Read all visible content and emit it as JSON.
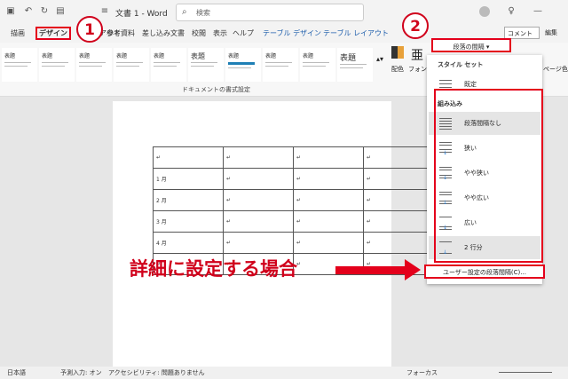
{
  "titlebar": {
    "doc_title": "文書 1 - Word",
    "search_placeholder": "検索"
  },
  "menu": {
    "tabs": [
      "描画",
      "デザイン",
      "レイアウト",
      "参考資料",
      "差し込み文書",
      "校閲",
      "表示",
      "ヘルプ",
      "テーブル デザイン",
      "テーブル レイアウト"
    ],
    "comment": "コメント",
    "edit": "編集"
  },
  "ribbon": {
    "gallery_caption": "ドキュメントの書式設定",
    "style_heading": "表題",
    "color_label": "配色",
    "font_label": "フォント",
    "page_color": "ページ色"
  },
  "document": {
    "rows": [
      "",
      "1 月",
      "2 月",
      "3 月",
      "4 月",
      ""
    ],
    "para_mark": "↵"
  },
  "dropdown": {
    "button_label": "段落の間隔",
    "style_set_header": "スタイル セット",
    "default_label": "既定",
    "builtin_header": "組み込み",
    "items": [
      "段落間隔なし",
      "狭い",
      "やや狭い",
      "やや広い",
      "広い",
      "2 行分"
    ],
    "custom_label": "ユーザー設定の段落間隔(C)..."
  },
  "annotations": {
    "circle1": "1",
    "circle2": "2",
    "callout": "詳細に設定する場合"
  },
  "status": {
    "lang": "日本語",
    "predict": "予測入力: オン",
    "access": "アクセシビリティ: 問題ありません",
    "focus": "フォーカス"
  },
  "colors": {
    "accent_red": "#e4001b",
    "word_blue": "#1f5fad"
  }
}
